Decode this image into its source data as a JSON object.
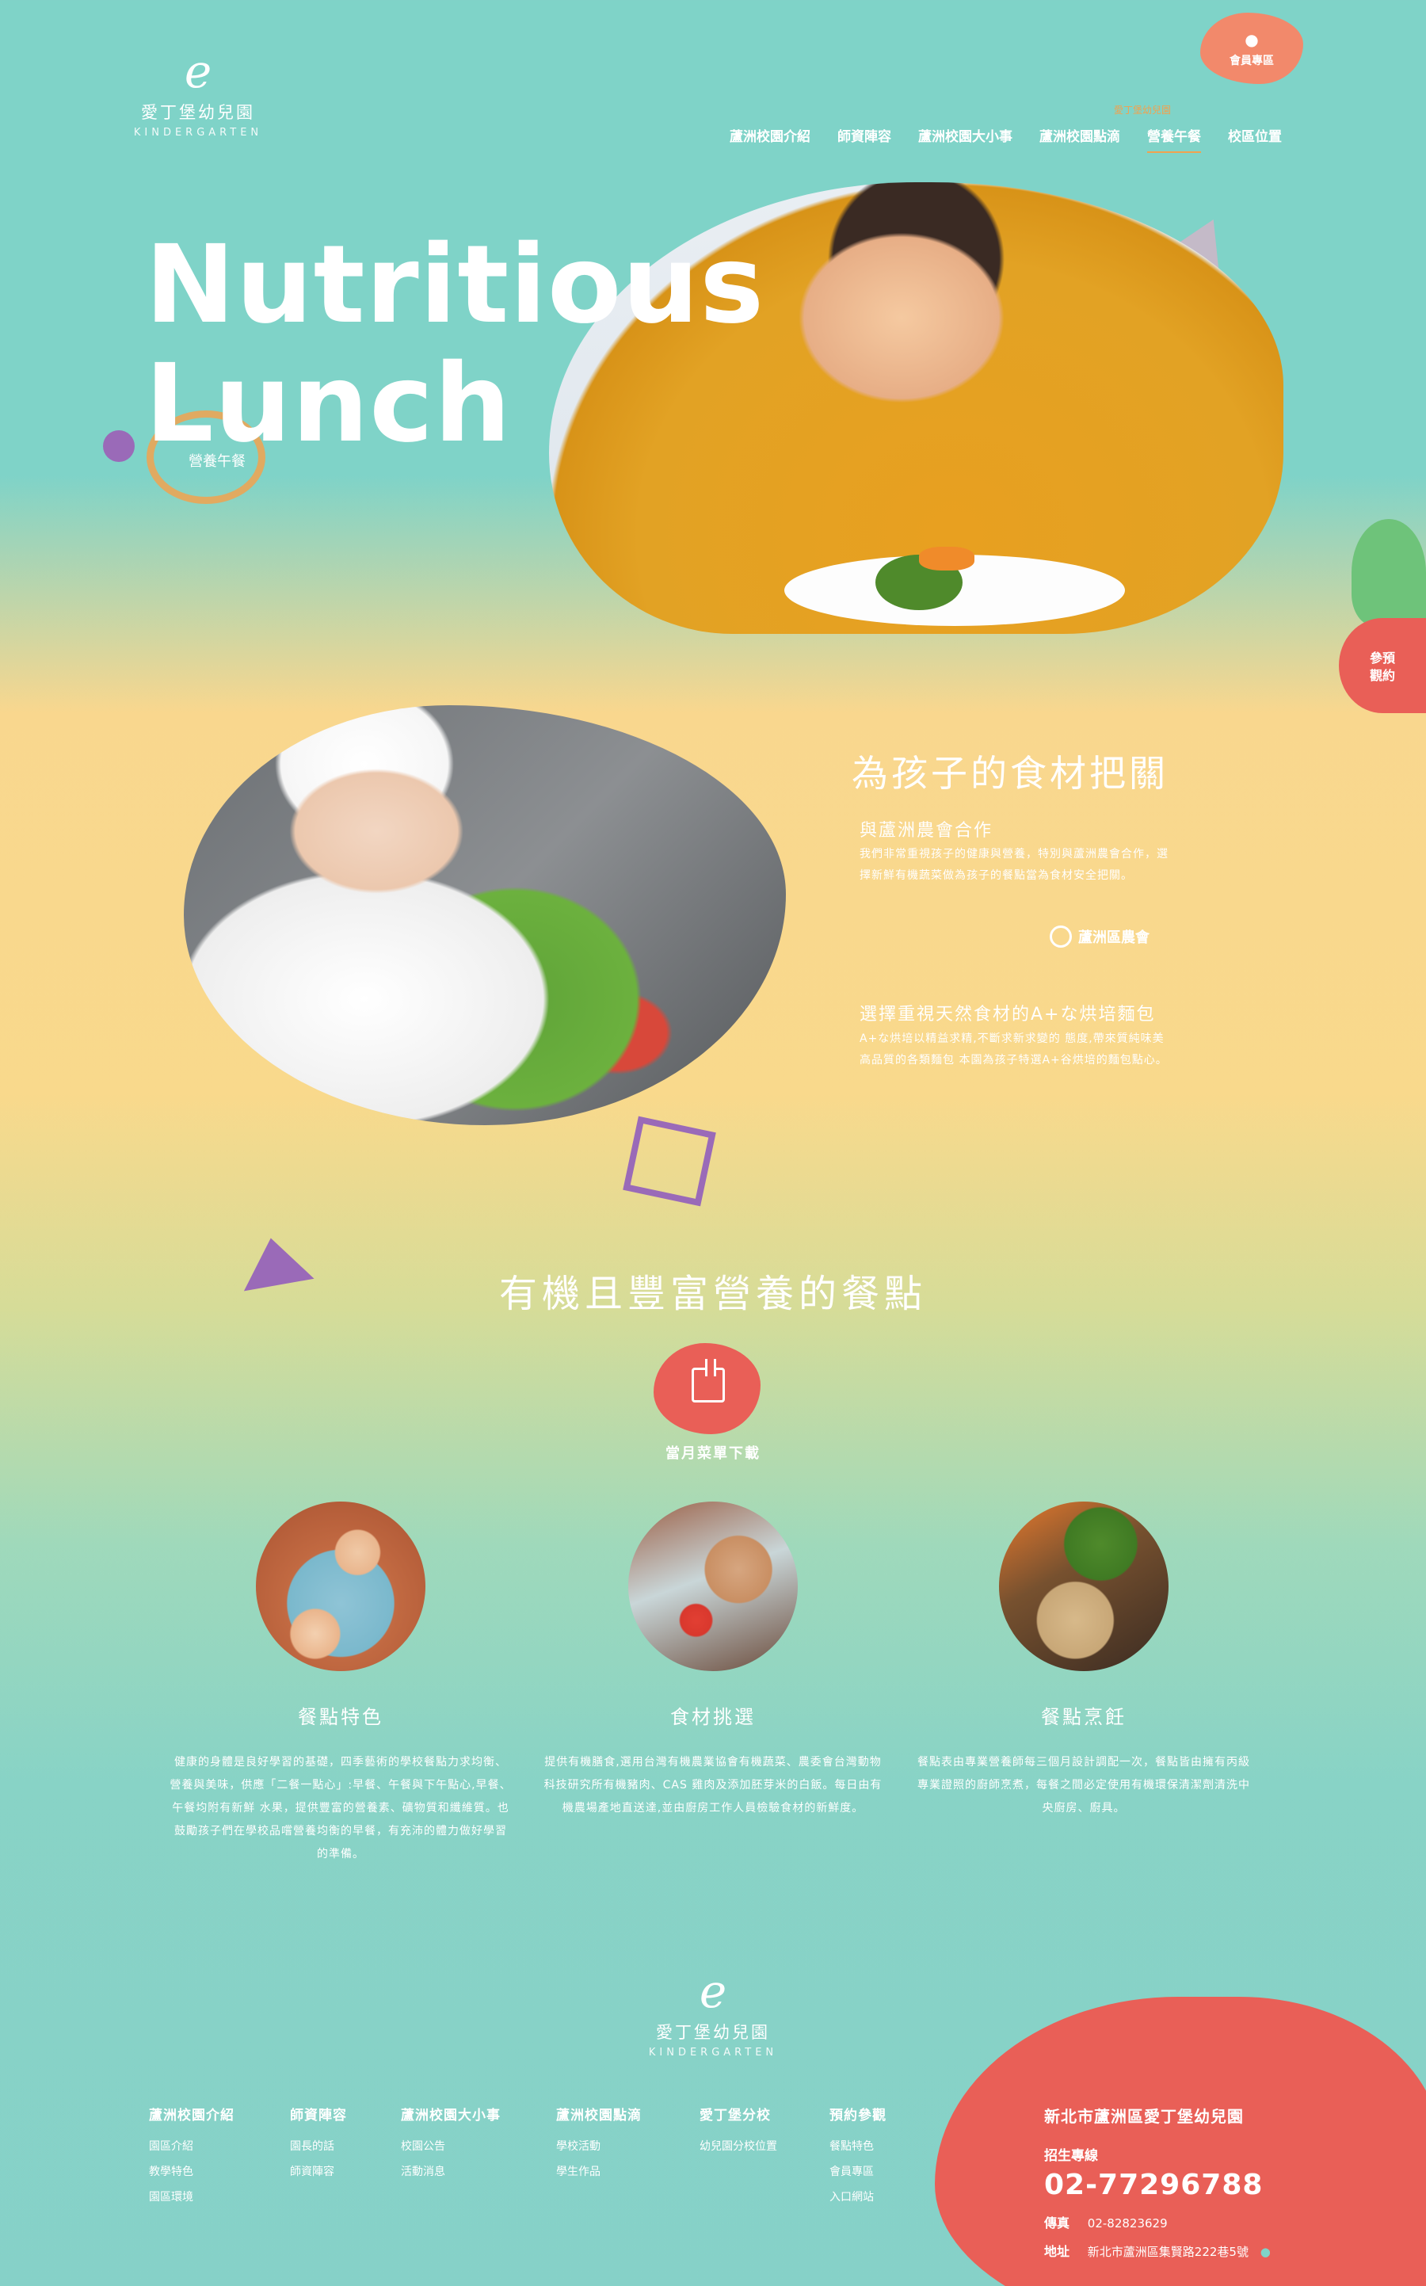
{
  "brand": {
    "mark": "e",
    "name": "愛丁堡幼兒園",
    "sub": "KINDERGARTEN"
  },
  "member": {
    "label": "會員專區"
  },
  "nav": {
    "active_tip": "愛丁堡幼兒園",
    "items": [
      "蘆洲校園介紹",
      "師資陣容",
      "蘆洲校園大小事",
      "蘆洲校園點滴",
      "營養午餐",
      "校區位置"
    ]
  },
  "hero": {
    "title_line1": "Nutritious",
    "title_line2": "Lunch",
    "subtitle": "營養午餐"
  },
  "side_badge": {
    "label": "參預觀約"
  },
  "section1": {
    "title": "為孩子的食材把關",
    "block1_heading": "與蘆洲農會合作",
    "block1_text": "我們非常重視孩子的健康與營養，特別與蘆洲農會合作，選擇新鮮有機蔬菜做為孩子的餐點當為食材安全把關。",
    "partner_logo": "蘆洲區農會",
    "block2_heading": "選擇重視天然食材的A+な烘培麵包",
    "block2_text": "A+な烘培以精益求精,不斷求新求變的 態度,帶來質純味美高品質的各類麵包 本園為孩子特選A+谷烘培的麵包點心。"
  },
  "section2": {
    "title": "有機且豐富營養的餐點",
    "download_label": "當月菜單下載",
    "features": [
      {
        "title": "餐點特色",
        "text": "健康的身體是良好學習的基礎，四季藝術的學校餐點力求均衡、營養與美味，供應「二餐一點心」:早餐、午餐與下午點心,早餐、午餐均附有新鮮 水果，提供豐富的營養素、礦物質和纖維質。也鼓勵孩子們在學校品嚐營養均衡的早餐，有充沛的體力做好學習的準備。"
      },
      {
        "title": "食材挑選",
        "text": "提供有機膳食,選用台灣有機農業協會有機蔬菜、農委會台灣動物科技研究所有機豬肉、CAS 雞肉及添加胚芽米的白飯。每日由有機農場產地直送達,並由廚房工作人員檢驗食材的新鮮度。"
      },
      {
        "title": "餐點烹飪",
        "text": "餐點表由專業營養師每三個月設計調配一次，餐點皆由擁有丙級專業證照的廚師烹煮，每餐之間必定使用有機環保清潔劑清洗中央廚房、廚具。"
      }
    ]
  },
  "footer": {
    "columns": [
      {
        "heading": "蘆洲校園介紹",
        "items": [
          "園區介紹",
          "教學特色",
          "園區環境"
        ]
      },
      {
        "heading": "師資陣容",
        "items": [
          "園長的話",
          "師資陣容"
        ]
      },
      {
        "heading": "蘆洲校園大小事",
        "items": [
          "校園公告",
          "活動消息"
        ]
      },
      {
        "heading": "蘆洲校園點滴",
        "items": [
          "學校活動",
          "學生作品"
        ]
      },
      {
        "heading": "愛丁堡分校",
        "items": [
          "幼兒園分校位置"
        ]
      },
      {
        "heading": "預約參觀",
        "items": [
          "餐點特色",
          "會員專區",
          "入口網站"
        ]
      }
    ],
    "contact": {
      "title": "新北市蘆洲區愛丁堡幼兒園",
      "hotline_label": "招生專線",
      "hotline": "02-77296788",
      "fax_label": "傳真",
      "fax": "02-82823629",
      "address_label": "地址",
      "address": "新北市蘆洲區集賢路222巷5號"
    }
  },
  "colors": {
    "accent_red": "#e95f57",
    "accent_orange": "#f1a24f",
    "teal": "#7fd3c8",
    "yellow": "#f9d78e",
    "purple": "#9a6ab8"
  }
}
